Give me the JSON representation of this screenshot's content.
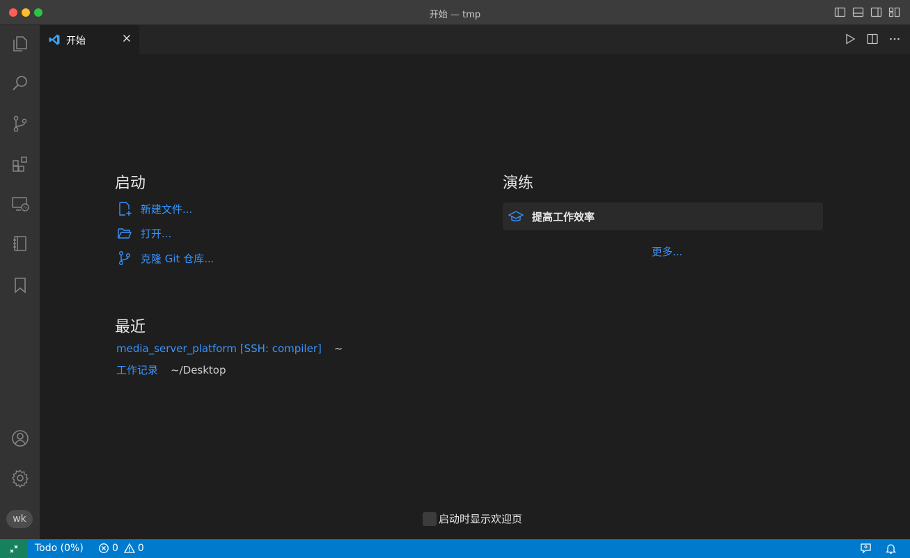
{
  "window": {
    "title": "开始 — tmp"
  },
  "tabs": [
    {
      "label": "开始",
      "active": true
    }
  ],
  "start": {
    "heading": "启动",
    "actions": [
      {
        "label": "新建文件...",
        "icon": "new-file-icon"
      },
      {
        "label": "打开...",
        "icon": "folder-open-icon"
      },
      {
        "label": "克隆 Git 仓库...",
        "icon": "git-branch-icon"
      }
    ]
  },
  "recent": {
    "heading": "最近",
    "items": [
      {
        "name": "media_server_platform [SSH: compiler]",
        "path": "~"
      },
      {
        "name": "工作记录",
        "path": "~/Desktop"
      }
    ]
  },
  "walkthroughs": {
    "heading": "演练",
    "items": [
      {
        "label": "提高工作效率",
        "icon": "mortarboard-icon"
      }
    ],
    "more_label": "更多..."
  },
  "footer": {
    "show_on_startup_label": "启动时显示欢迎页",
    "checked": false
  },
  "account": {
    "badge": "wk"
  },
  "statusbar": {
    "todo_label": "Todo (0%)",
    "errors": "0",
    "warnings": "0"
  },
  "colors": {
    "accent": "#007acc",
    "link": "#3794ff",
    "remote": "#16825d"
  }
}
